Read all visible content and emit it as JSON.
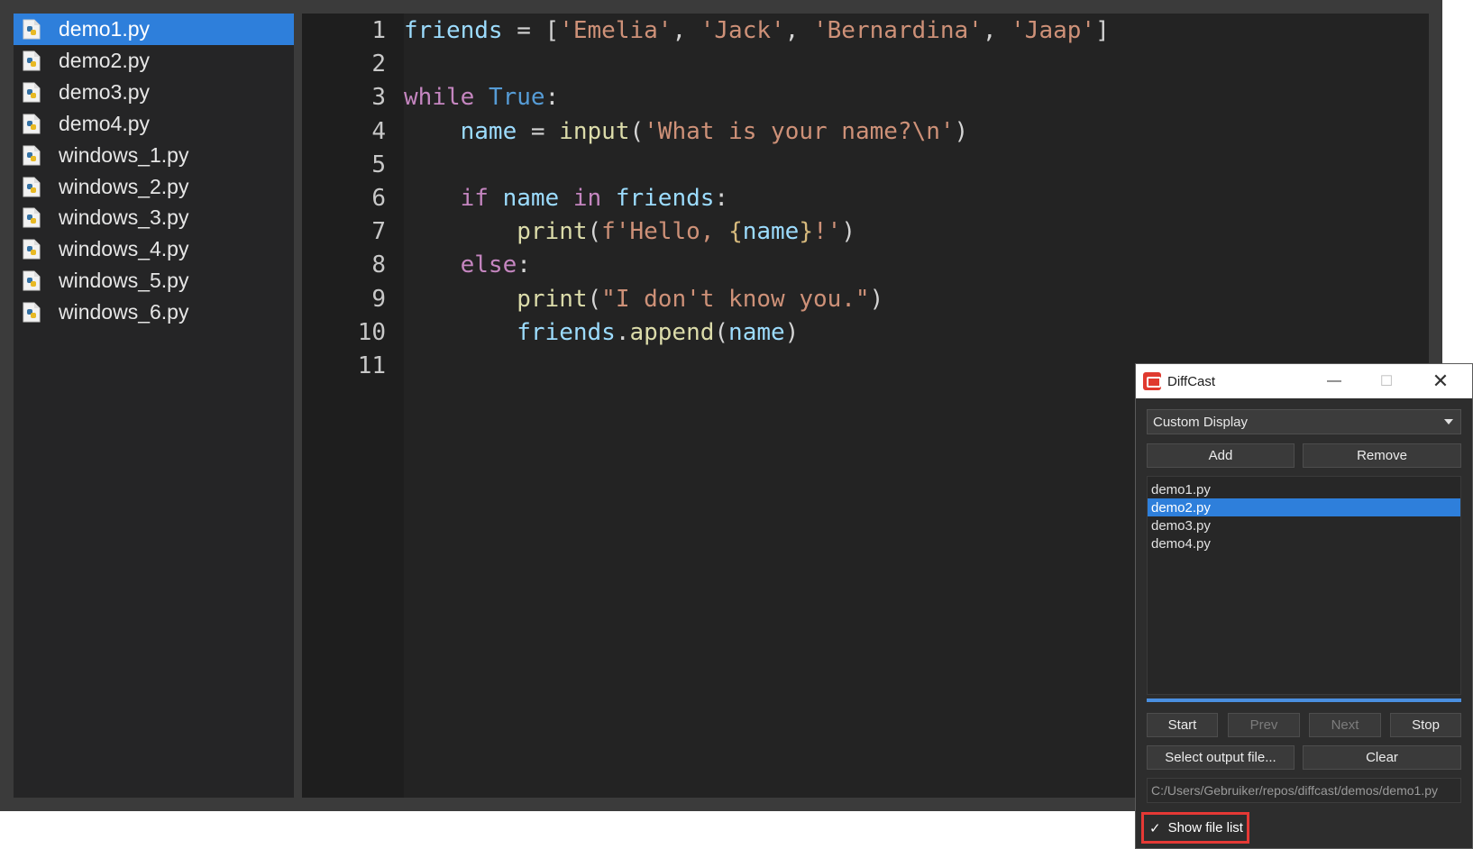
{
  "editor": {
    "files": [
      {
        "name": "demo1.py",
        "selected": true
      },
      {
        "name": "demo2.py",
        "selected": false
      },
      {
        "name": "demo3.py",
        "selected": false
      },
      {
        "name": "demo4.py",
        "selected": false
      },
      {
        "name": "windows_1.py",
        "selected": false
      },
      {
        "name": "windows_2.py",
        "selected": false
      },
      {
        "name": "windows_3.py",
        "selected": false
      },
      {
        "name": "windows_4.py",
        "selected": false
      },
      {
        "name": "windows_5.py",
        "selected": false
      },
      {
        "name": "windows_6.py",
        "selected": false
      }
    ],
    "line_numbers": [
      "1",
      "2",
      "3",
      "4",
      "5",
      "6",
      "7",
      "8",
      "9",
      "10",
      "11"
    ],
    "code_lines": [
      [
        [
          "friends",
          "var"
        ],
        [
          " = [",
          "punc"
        ],
        [
          "'Emelia'",
          "str"
        ],
        [
          ", ",
          "punc"
        ],
        [
          "'Jack'",
          "str"
        ],
        [
          ", ",
          "punc"
        ],
        [
          "'Bernardina'",
          "str"
        ],
        [
          ", ",
          "punc"
        ],
        [
          "'Jaap'",
          "str"
        ],
        [
          "]",
          "punc"
        ]
      ],
      [],
      [
        [
          "while",
          "kw"
        ],
        [
          " ",
          "punc"
        ],
        [
          "True",
          "const"
        ],
        [
          ":",
          "punc"
        ]
      ],
      [
        [
          "    ",
          "punc"
        ],
        [
          "name",
          "var"
        ],
        [
          " = ",
          "punc"
        ],
        [
          "input",
          "func"
        ],
        [
          "(",
          "punc"
        ],
        [
          "'What is your name?\\n'",
          "str"
        ],
        [
          ")",
          "punc"
        ]
      ],
      [],
      [
        [
          "    ",
          "punc"
        ],
        [
          "if",
          "kw"
        ],
        [
          " ",
          "punc"
        ],
        [
          "name",
          "var"
        ],
        [
          " ",
          "punc"
        ],
        [
          "in",
          "kw"
        ],
        [
          " ",
          "punc"
        ],
        [
          "friends",
          "var"
        ],
        [
          ":",
          "punc"
        ]
      ],
      [
        [
          "        ",
          "punc"
        ],
        [
          "print",
          "func"
        ],
        [
          "(",
          "punc"
        ],
        [
          "f'Hello, ",
          "str"
        ],
        [
          "{",
          "brace"
        ],
        [
          "name",
          "var"
        ],
        [
          "}",
          "brace"
        ],
        [
          "!'",
          "str"
        ],
        [
          ")",
          "punc"
        ]
      ],
      [
        [
          "    ",
          "punc"
        ],
        [
          "else",
          "kw"
        ],
        [
          ":",
          "punc"
        ]
      ],
      [
        [
          "        ",
          "punc"
        ],
        [
          "print",
          "func"
        ],
        [
          "(",
          "punc"
        ],
        [
          "\"I don't know you.\"",
          "str"
        ],
        [
          ")",
          "punc"
        ]
      ],
      [
        [
          "        ",
          "punc"
        ],
        [
          "friends",
          "var"
        ],
        [
          ".",
          "punc"
        ],
        [
          "append",
          "func"
        ],
        [
          "(",
          "punc"
        ],
        [
          "name",
          "var"
        ],
        [
          ")",
          "punc"
        ]
      ],
      []
    ]
  },
  "colors": {
    "var": "#9cdcfe",
    "kw": "#c586c0",
    "const": "#569cd6",
    "func": "#dcdcaa",
    "str": "#ce9178",
    "punc": "#d4d4d4",
    "brace": "#d7ba7d",
    "selection": "#2e7fdb"
  },
  "diffcast": {
    "title": "DiffCast",
    "minimize": "—",
    "maximize": "☐",
    "close": "✕",
    "display_select": "Custom Display",
    "add_label": "Add",
    "remove_label": "Remove",
    "files": [
      {
        "name": "demo1.py",
        "selected": false
      },
      {
        "name": "demo2.py",
        "selected": true
      },
      {
        "name": "demo3.py",
        "selected": false
      },
      {
        "name": "demo4.py",
        "selected": false
      }
    ],
    "progress": 1.0,
    "start_label": "Start",
    "prev_label": "Prev",
    "next_label": "Next",
    "stop_label": "Stop",
    "select_output_label": "Select output file...",
    "clear_label": "Clear",
    "output_path": "C:/Users/Gebruiker/repos/diffcast/demos/demo1.py",
    "show_file_list_label": "Show file list",
    "show_file_list_checked": true
  }
}
